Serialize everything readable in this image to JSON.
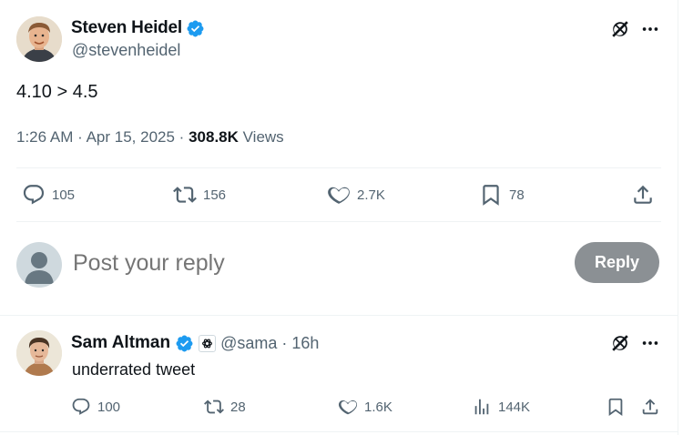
{
  "tweet": {
    "author": {
      "name": "Steven Heidel",
      "handle": "@stevenheidel",
      "verified": true
    },
    "text": "4.10 > 4.5",
    "time": "1:26 AM",
    "separator": "·",
    "date": "Apr 15, 2025",
    "views_count": "308.8K",
    "views_label": "Views",
    "stats": {
      "replies": "105",
      "reposts": "156",
      "likes": "2.7K",
      "bookmarks": "78"
    }
  },
  "composer": {
    "placeholder": "Post your reply",
    "button_label": "Reply"
  },
  "reply": {
    "author": {
      "name": "Sam Altman",
      "handle": "@sama",
      "verified": true,
      "affiliate_badge": "openai-logo-icon"
    },
    "separator": "·",
    "time_ago": "16h",
    "text": "underrated tweet",
    "stats": {
      "replies": "100",
      "reposts": "28",
      "likes": "1.6K",
      "views": "144K"
    }
  },
  "colors": {
    "text": "#0f1419",
    "secondary": "#536471",
    "verified": "#1d9bf0",
    "reply_button": "#8b9094",
    "divider": "#eff3f4"
  }
}
